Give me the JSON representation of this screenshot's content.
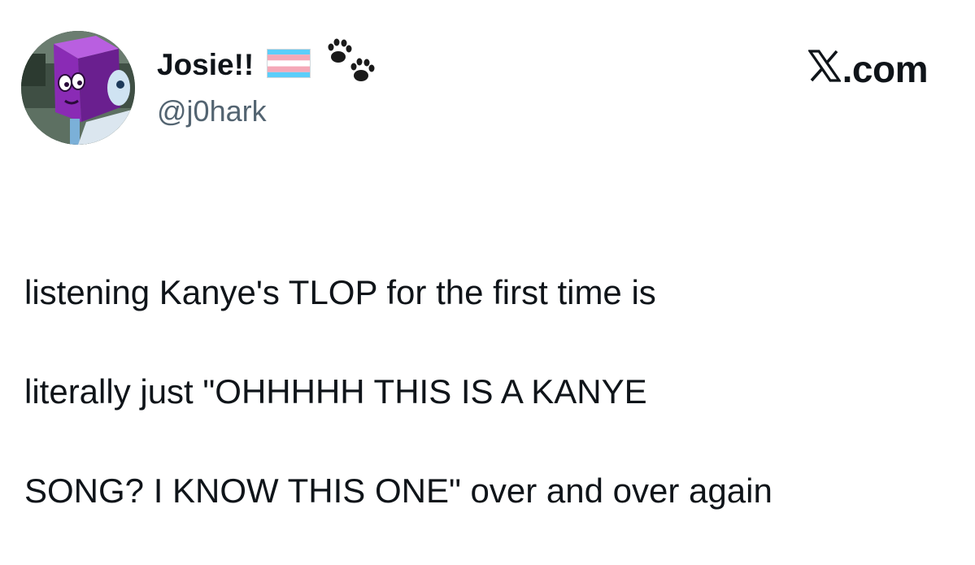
{
  "author": {
    "display_name": "Josie!!",
    "handle": "@j0hark",
    "badges": [
      "transgender-flag-icon",
      "paw-prints-icon"
    ]
  },
  "source": {
    "logo": "x-logo-icon",
    "label": ".com"
  },
  "tweet": {
    "text_lines": [
      "listening Kanye's TLOP for the first time is",
      "literally just \"OHHHHH THIS IS A KANYE",
      "SONG? I KNOW THIS ONE\" over and over again"
    ]
  },
  "colors": {
    "text": "#0f1419",
    "secondary_text": "#536471",
    "flag_blue": "#5BCEFA",
    "flag_pink": "#F5A9B8",
    "flag_white": "#FFFFFF",
    "avatar_purple": "#8a2bb5"
  }
}
